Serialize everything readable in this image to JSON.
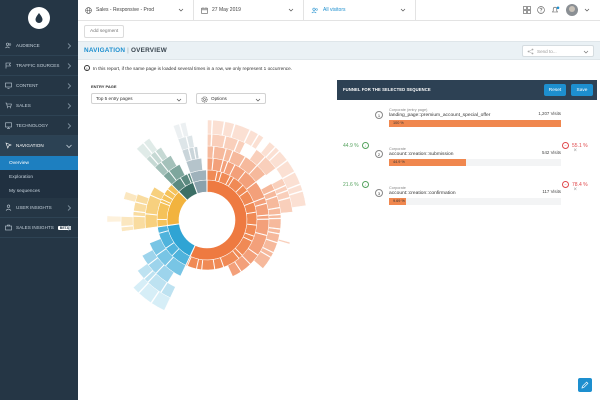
{
  "topbar": {
    "site_label": "Sales - Responsive - Prod",
    "date_label": "27 May 2019",
    "segment_label": "All visitors"
  },
  "segment_row": {
    "add_segment_label": "Add segment"
  },
  "sidebar": {
    "items": [
      {
        "label": "Audience",
        "icon": "users-icon"
      },
      {
        "label": "Traffic sources",
        "icon": "flag-icon"
      },
      {
        "label": "Content",
        "icon": "monitor-icon"
      },
      {
        "label": "Sales",
        "icon": "cart-icon"
      },
      {
        "label": "Technology",
        "icon": "desktop-icon"
      },
      {
        "label": "Navigation",
        "icon": "cursor-icon",
        "open": true
      },
      {
        "label": "User insights",
        "icon": "user-icon"
      },
      {
        "label": "Sales insights",
        "icon": "briefcase-icon",
        "badge": "beta"
      }
    ],
    "sub_items": [
      {
        "label": "Overview",
        "active": true
      },
      {
        "label": "Exploration"
      },
      {
        "label": "My sequences"
      }
    ]
  },
  "header": {
    "section": "NAVIGATION",
    "separator": "|",
    "page": "OVERVIEW",
    "send_to_placeholder": "Send to..."
  },
  "info_text": "In this report, if the same page is loaded several times in a row, we only represent 1 occurrence.",
  "entry_page": {
    "label": "Entry page",
    "selected": "Top 5 entry pages",
    "options_label": "Options"
  },
  "funnel": {
    "title": "Funnel for the selected sequence",
    "reset_label": "Reset",
    "save_label": "Save",
    "steps": [
      {
        "num": "1",
        "category": "Corporate (entry page)",
        "page": "landing_page::premium_account_special_offer",
        "visits": "1,207 Visits",
        "bar_label": "100 %",
        "bar_pct": 100
      },
      {
        "num": "2",
        "category": "Corporate",
        "page": "account::creation::submission",
        "visits": "542 Visits",
        "bar_label": "44.9 %",
        "bar_pct": 44.9
      },
      {
        "num": "3",
        "category": "Corporate",
        "page": "account::creation::confirmation",
        "visits": "117 Visits",
        "bar_label": "9.69 %",
        "bar_pct": 9.69
      }
    ],
    "conversions": [
      "44.9 %",
      "21.6 %"
    ],
    "dropoffs": [
      "55.1 %",
      "78.4 %"
    ]
  },
  "colors": {
    "sidebar_bg": "#253645",
    "accent": "#1d8fcf",
    "funnel_bar": "#f0874e",
    "conversion": "#55a25e",
    "dropoff": "#e0484b"
  }
}
